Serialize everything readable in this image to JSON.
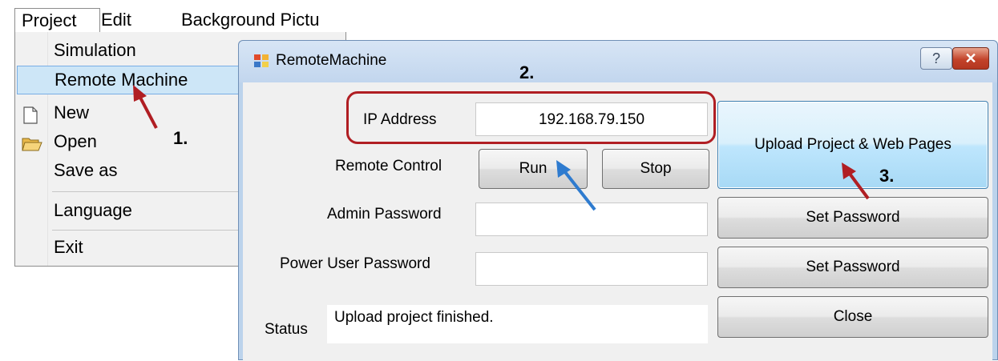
{
  "menubar": {
    "items": [
      {
        "label": "Project"
      },
      {
        "label": "Edit"
      },
      {
        "label": "Background Pictu"
      }
    ]
  },
  "dropdown": {
    "items": [
      {
        "label": "Simulation",
        "icon": ""
      },
      {
        "label": "Remote Machine",
        "icon": "",
        "highlighted": true
      },
      {
        "label": "New",
        "icon": "new-document-icon"
      },
      {
        "label": "Open",
        "icon": "open-folder-icon"
      },
      {
        "label": "Save as",
        "icon": ""
      },
      {
        "label": "Language",
        "icon": ""
      },
      {
        "label": "Exit",
        "icon": ""
      }
    ]
  },
  "dialog": {
    "title": "RemoteMachine",
    "icon": "app-window-icon",
    "help_label": "?",
    "close_label": "✕",
    "ip_label": "IP Address",
    "ip_value": "192.168.79.150",
    "remote_control_label": "Remote Control",
    "run_label": "Run",
    "stop_label": "Stop",
    "admin_password_label": "Admin Password",
    "admin_password_value": "",
    "power_user_password_label": "Power User Password",
    "power_user_password_value": "",
    "status_label": "Status",
    "status_value": "Upload project finished.",
    "upload_label": "Upload Project & Web Pages",
    "set_password_admin_label": "Set Password",
    "set_password_power_label": "Set Password",
    "close_button_label": "Close"
  },
  "annotations": {
    "step1": "1.",
    "step2": "2.",
    "step3": "3.",
    "highlight_color": "#b01e23",
    "arrow_red": "#b01e23",
    "arrow_blue": "#2e7bcf"
  },
  "colors": {
    "menu_highlight": "#cde6f7",
    "dialog_frame": "#bcd3ec",
    "client_bg": "#f0f0f0"
  }
}
